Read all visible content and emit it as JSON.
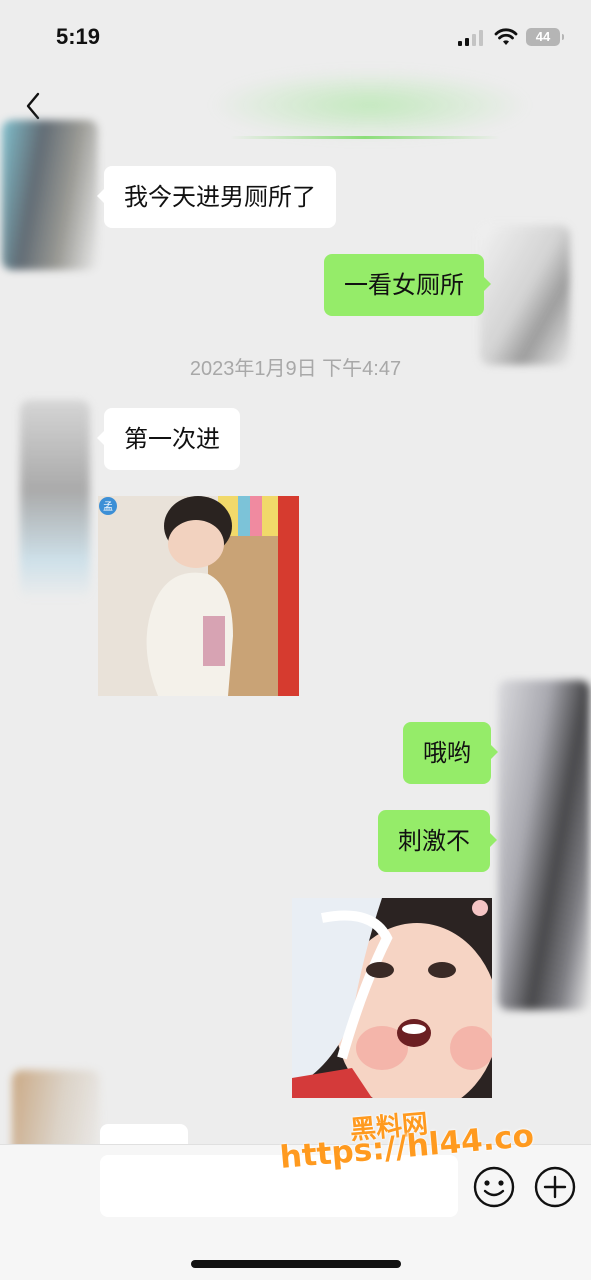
{
  "status_bar": {
    "time": "5:19",
    "battery": "44"
  },
  "nav": {
    "back_icon": "chevron-left-icon"
  },
  "messages": [
    {
      "side": "in",
      "type": "text",
      "text": "我今天进男厕所了"
    },
    {
      "side": "out",
      "type": "text",
      "text": "一看女厕所"
    },
    {
      "type": "timestamp",
      "text": "2023年1月9日 下午4:47"
    },
    {
      "side": "in",
      "type": "text",
      "text": "第一次进"
    },
    {
      "side": "in",
      "type": "sticker",
      "sticker": "girl-leaning-on-door-sticker"
    },
    {
      "side": "out",
      "type": "text",
      "text": "哦哟"
    },
    {
      "side": "out",
      "type": "text",
      "text": "刺激不"
    },
    {
      "side": "out",
      "type": "sticker",
      "sticker": "surprised-toddler-sticker"
    }
  ],
  "input_bar": {
    "emoji_icon": "smiley-face-icon",
    "plus_icon": "plus-circle-icon"
  },
  "watermark": {
    "line1": "黑料网",
    "line2": "https://hl44.co"
  },
  "colors": {
    "background": "#ededed",
    "incoming_bubble": "#ffffff",
    "outgoing_bubble": "#95ec69",
    "watermark": "#ff9a1f"
  }
}
